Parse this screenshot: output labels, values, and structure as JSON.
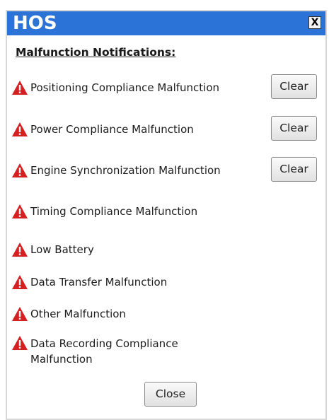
{
  "window": {
    "title": "HOS",
    "close_glyph": "X"
  },
  "heading": "Malfunction Notifications:",
  "malfunctions": [
    {
      "label": "Positioning Compliance Malfunction",
      "icon": "warning-triangle-icon",
      "has_clear": true,
      "clear_label": "Clear"
    },
    {
      "label": "Power Compliance Malfunction",
      "icon": "warning-triangle-icon",
      "has_clear": true,
      "clear_label": "Clear"
    },
    {
      "label": "Engine Synchronization Malfunction",
      "icon": "warning-triangle-icon",
      "has_clear": true,
      "clear_label": "Clear"
    },
    {
      "label": "Timing Compliance Malfunction",
      "icon": "warning-triangle-icon",
      "has_clear": false
    },
    {
      "label": "Low Battery",
      "icon": "warning-triangle-icon",
      "has_clear": false
    },
    {
      "label": "Data Transfer Malfunction",
      "icon": "warning-triangle-icon",
      "has_clear": false
    },
    {
      "label": "Other Malfunction",
      "icon": "warning-triangle-icon",
      "has_clear": false
    },
    {
      "label": "Data Recording Compliance Malfunction",
      "icon": "warning-triangle-icon",
      "has_clear": false
    }
  ],
  "footer": {
    "close_label": "Close"
  },
  "colors": {
    "titlebar": "#2b73d6",
    "warning": "#d42020"
  }
}
